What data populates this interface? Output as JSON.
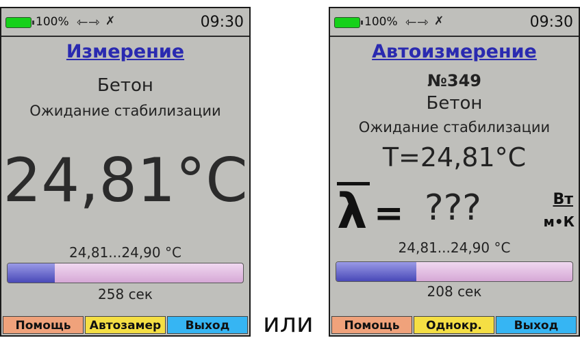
{
  "screen1": {
    "status": {
      "battery": "100%",
      "time": "09:30"
    },
    "title": "Измерение",
    "material": "Бетон",
    "status_text": "Ожидание стабилизации",
    "temperature": "24,81°C",
    "range": "24,81...24,90  °C",
    "progress": 0.2,
    "seconds": "258  сек",
    "keys": {
      "help": "Помощь",
      "mid": "Автозамер",
      "exit": "Выход"
    }
  },
  "separator": "или",
  "screen2": {
    "status": {
      "battery": "100%",
      "time": "09:30"
    },
    "title": "Автоизмерение",
    "number": "№349",
    "material": "Бетон",
    "status_text": "Ожидание стабилизации",
    "temperature": "T=24,81°C",
    "lambda": "λ",
    "equals": "=",
    "lambda_value": "???",
    "unit_num": "Вт",
    "unit_den": "м•К",
    "range": "24,81...24,90  °C",
    "progress": 0.34,
    "seconds": "208  сек",
    "keys": {
      "help": "Помощь",
      "mid": "Однокр.",
      "exit": "Выход"
    }
  },
  "icons": {
    "battery": "battery-icon",
    "usb": "usb-icon",
    "tool": "antenna-icon"
  },
  "colors": {
    "title": "#2a2ab0",
    "battery": "#16d11a",
    "progress_fill": "#4949b8",
    "key_help": "#f0a27b",
    "key_mid": "#f5df44",
    "key_exit": "#36b5f3"
  }
}
